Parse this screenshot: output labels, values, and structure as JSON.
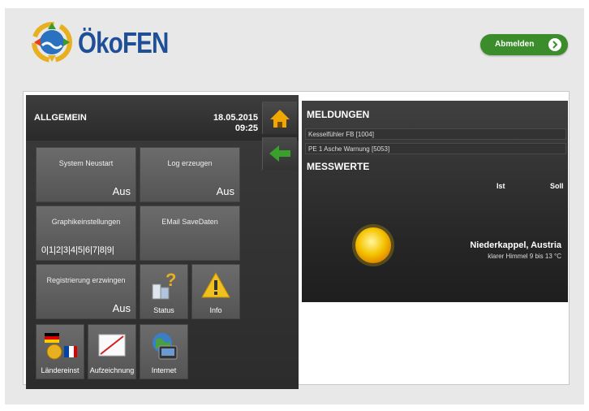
{
  "brand": {
    "logo_text": "ÖkoFEN"
  },
  "header": {
    "logout_label": "Abmelden"
  },
  "colors": {
    "brand_blue": "#1f4f97",
    "logout_green": "#3a8d2a",
    "panel_dark": "#2e2e2e",
    "tile_gray": "#606060"
  },
  "left_panel": {
    "title": "ALLGEMEIN",
    "date": "18.05.2015",
    "time": "09:25",
    "tiles": [
      {
        "label": "System Neustart",
        "value": "Aus"
      },
      {
        "label": "Log erzeugen",
        "value": "Aus"
      },
      {
        "label": "Graphikeinstellungen",
        "value": "0|1|2|3|4|5|6|7|8|9|"
      },
      {
        "label": "EMail SaveDaten",
        "value": ""
      },
      {
        "label": "Registrierung erzwingen",
        "value": "Aus"
      },
      {
        "label": "Status",
        "icon": "status-icon"
      },
      {
        "label": "Info",
        "icon": "warning-icon"
      },
      {
        "label": "Ländereinst",
        "icon": "flags-icon"
      },
      {
        "label": "Aufzeichnung",
        "icon": "chart-icon"
      },
      {
        "label": "Internet",
        "icon": "globe-icon"
      }
    ],
    "side_buttons": [
      {
        "icon": "home-icon"
      },
      {
        "icon": "back-arrow-icon"
      }
    ]
  },
  "right_panel": {
    "messages_title": "MELDUNGEN",
    "messages": [
      "Kesselfühler FB [1004]",
      "PE 1 Asche Warnung [5053]"
    ],
    "values_title": "MESSWERTE",
    "col_ist": "Ist",
    "col_soll": "Soll",
    "location": "Niederkappel, Austria",
    "weather": "klarer Himmel 9 bis 13 °C"
  }
}
